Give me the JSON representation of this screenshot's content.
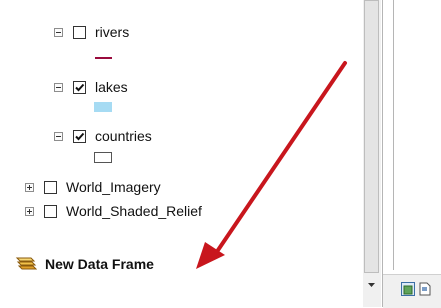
{
  "toc": {
    "layers": [
      {
        "label": "rivers",
        "checked": false,
        "expanded": true
      },
      {
        "label": "lakes",
        "checked": true,
        "expanded": true
      },
      {
        "label": "countries",
        "checked": true,
        "expanded": true
      },
      {
        "label": "World_Imagery",
        "checked": false,
        "expanded": false
      },
      {
        "label": "World_Shaded_Relief",
        "checked": false,
        "expanded": false
      }
    ],
    "data_frame": {
      "label": "New Data Frame",
      "icon": "layers-icon"
    }
  },
  "colors": {
    "river_symbol": "#9a0b3d",
    "lake_symbol": "#a6dbf3",
    "arrow": "#c8161d"
  }
}
